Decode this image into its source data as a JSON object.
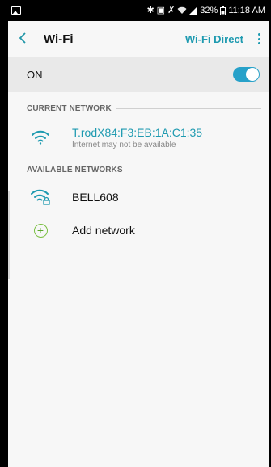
{
  "status_bar": {
    "battery": "32%",
    "time": "11:18 AM",
    "icons": [
      "image-icon",
      "bluetooth-icon",
      "nfc-icon",
      "mute-icon",
      "wifi-signal-icon",
      "cell-signal-icon",
      "battery-icon"
    ]
  },
  "header": {
    "title": "Wi-Fi",
    "wifi_direct": "Wi-Fi Direct"
  },
  "toggle_row": {
    "label": "ON",
    "state": true,
    "accent": "#27a1c9"
  },
  "current_network": {
    "section_label": "CURRENT NETWORK",
    "name": "T.rodX84:F3:EB:1A:C1:35",
    "status": "Internet may not be available"
  },
  "available_networks": {
    "section_label": "AVAILABLE NETWORKS",
    "items": [
      {
        "name": "BELL608",
        "secured": true
      }
    ],
    "add_label": "Add network"
  },
  "colors": {
    "accent": "#1e9ab0",
    "add_green": "#7bc043"
  }
}
